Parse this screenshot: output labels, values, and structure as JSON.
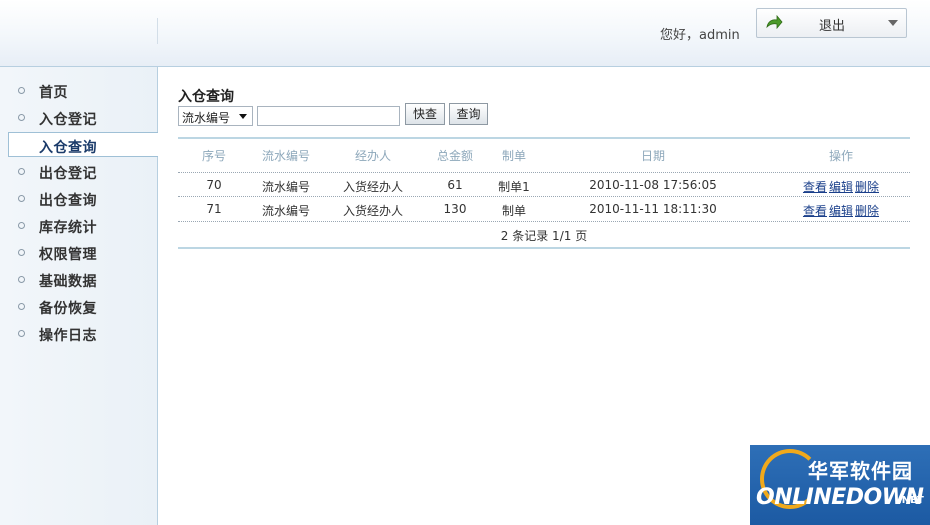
{
  "header": {
    "greeting": "您好，admin",
    "logout_label": "退出"
  },
  "sidebar": {
    "items": [
      {
        "label": "首页"
      },
      {
        "label": "入仓登记"
      },
      {
        "label": "入仓查询"
      },
      {
        "label": "出仓登记"
      },
      {
        "label": "出仓查询"
      },
      {
        "label": "库存统计"
      },
      {
        "label": "权限管理"
      },
      {
        "label": "基础数据"
      },
      {
        "label": "备份恢复"
      },
      {
        "label": "操作日志"
      }
    ],
    "active_index": 2
  },
  "main": {
    "title": "入仓查询",
    "search": {
      "field_selected": "流水编号",
      "input_value": "",
      "quick_button": "快查",
      "query_button": "查询"
    },
    "table": {
      "columns": [
        "序号",
        "流水编号",
        "经办人",
        "总金额",
        "制单",
        "日期",
        "操作"
      ],
      "rows": [
        {
          "id": "70",
          "serial": "流水编号",
          "handler": "入货经办人",
          "amount": "61",
          "maker": "制单1",
          "date": "2010-11-08 17:56:05",
          "ops": [
            "查看",
            "编辑",
            "删除"
          ]
        },
        {
          "id": "71",
          "serial": "流水编号",
          "handler": "入货经办人",
          "amount": "130",
          "maker": "制单",
          "date": "2010-11-11 18:11:30",
          "ops": [
            "查看",
            "编辑",
            "删除"
          ]
        }
      ],
      "footer": "2 条记录  1/1 页"
    }
  },
  "watermark": {
    "cn": "华军软件园",
    "en": "ONLINEDOWN",
    "suffix": ".NET"
  },
  "colors": {
    "accent_border": "#b7cfe0",
    "link": "#1a3f8a",
    "header_text_muted": "#8ea8bb",
    "logo_bg": "#2e6fb7"
  }
}
